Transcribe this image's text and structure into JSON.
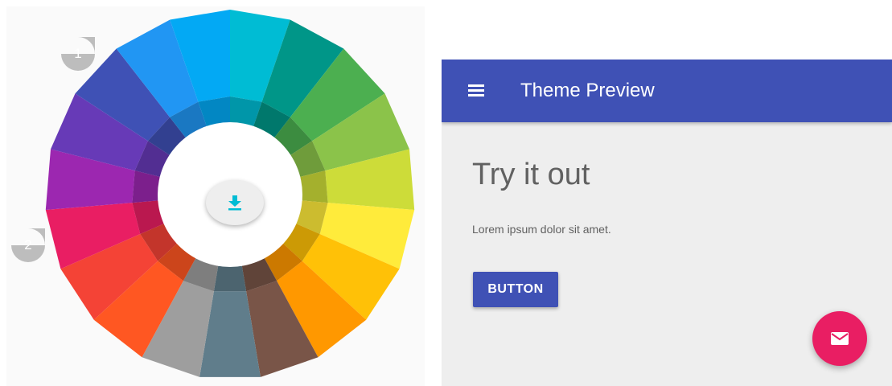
{
  "color_wheel": {
    "segments": [
      {
        "name": "cyan",
        "color": "#00bcd4"
      },
      {
        "name": "teal",
        "color": "#009688"
      },
      {
        "name": "green",
        "color": "#4caf50"
      },
      {
        "name": "light-green",
        "color": "#8bc34a"
      },
      {
        "name": "lime",
        "color": "#cddc39"
      },
      {
        "name": "yellow",
        "color": "#ffeb3b"
      },
      {
        "name": "amber",
        "color": "#ffc107"
      },
      {
        "name": "orange",
        "color": "#ff9800"
      },
      {
        "name": "brown",
        "color": "#795548"
      },
      {
        "name": "blue-grey",
        "color": "#607d8b"
      },
      {
        "name": "grey",
        "color": "#9e9e9e"
      },
      {
        "name": "deep-orange",
        "color": "#ff5722"
      },
      {
        "name": "red",
        "color": "#f44336"
      },
      {
        "name": "pink",
        "color": "#e91e63"
      },
      {
        "name": "purple",
        "color": "#9c27b0"
      },
      {
        "name": "deep-purple",
        "color": "#673ab7"
      },
      {
        "name": "indigo",
        "color": "#3f51b5"
      },
      {
        "name": "blue",
        "color": "#2196f3"
      },
      {
        "name": "light-blue",
        "color": "#03a9f4"
      }
    ],
    "markers": [
      {
        "label": "1",
        "selected_color": "indigo"
      },
      {
        "label": "2",
        "selected_color": "pink"
      }
    ],
    "download_icon": "download-icon",
    "download_icon_color": "#00bcd4"
  },
  "preview": {
    "toolbar": {
      "title": "Theme Preview",
      "menu_icon": "menu-icon",
      "color": "#3f51b5"
    },
    "heading": "Try it out",
    "body_text": "Lorem ipsum dolor sit amet.",
    "button_label": "BUTTON",
    "fab": {
      "icon": "mail-icon",
      "color": "#e91e63"
    }
  }
}
